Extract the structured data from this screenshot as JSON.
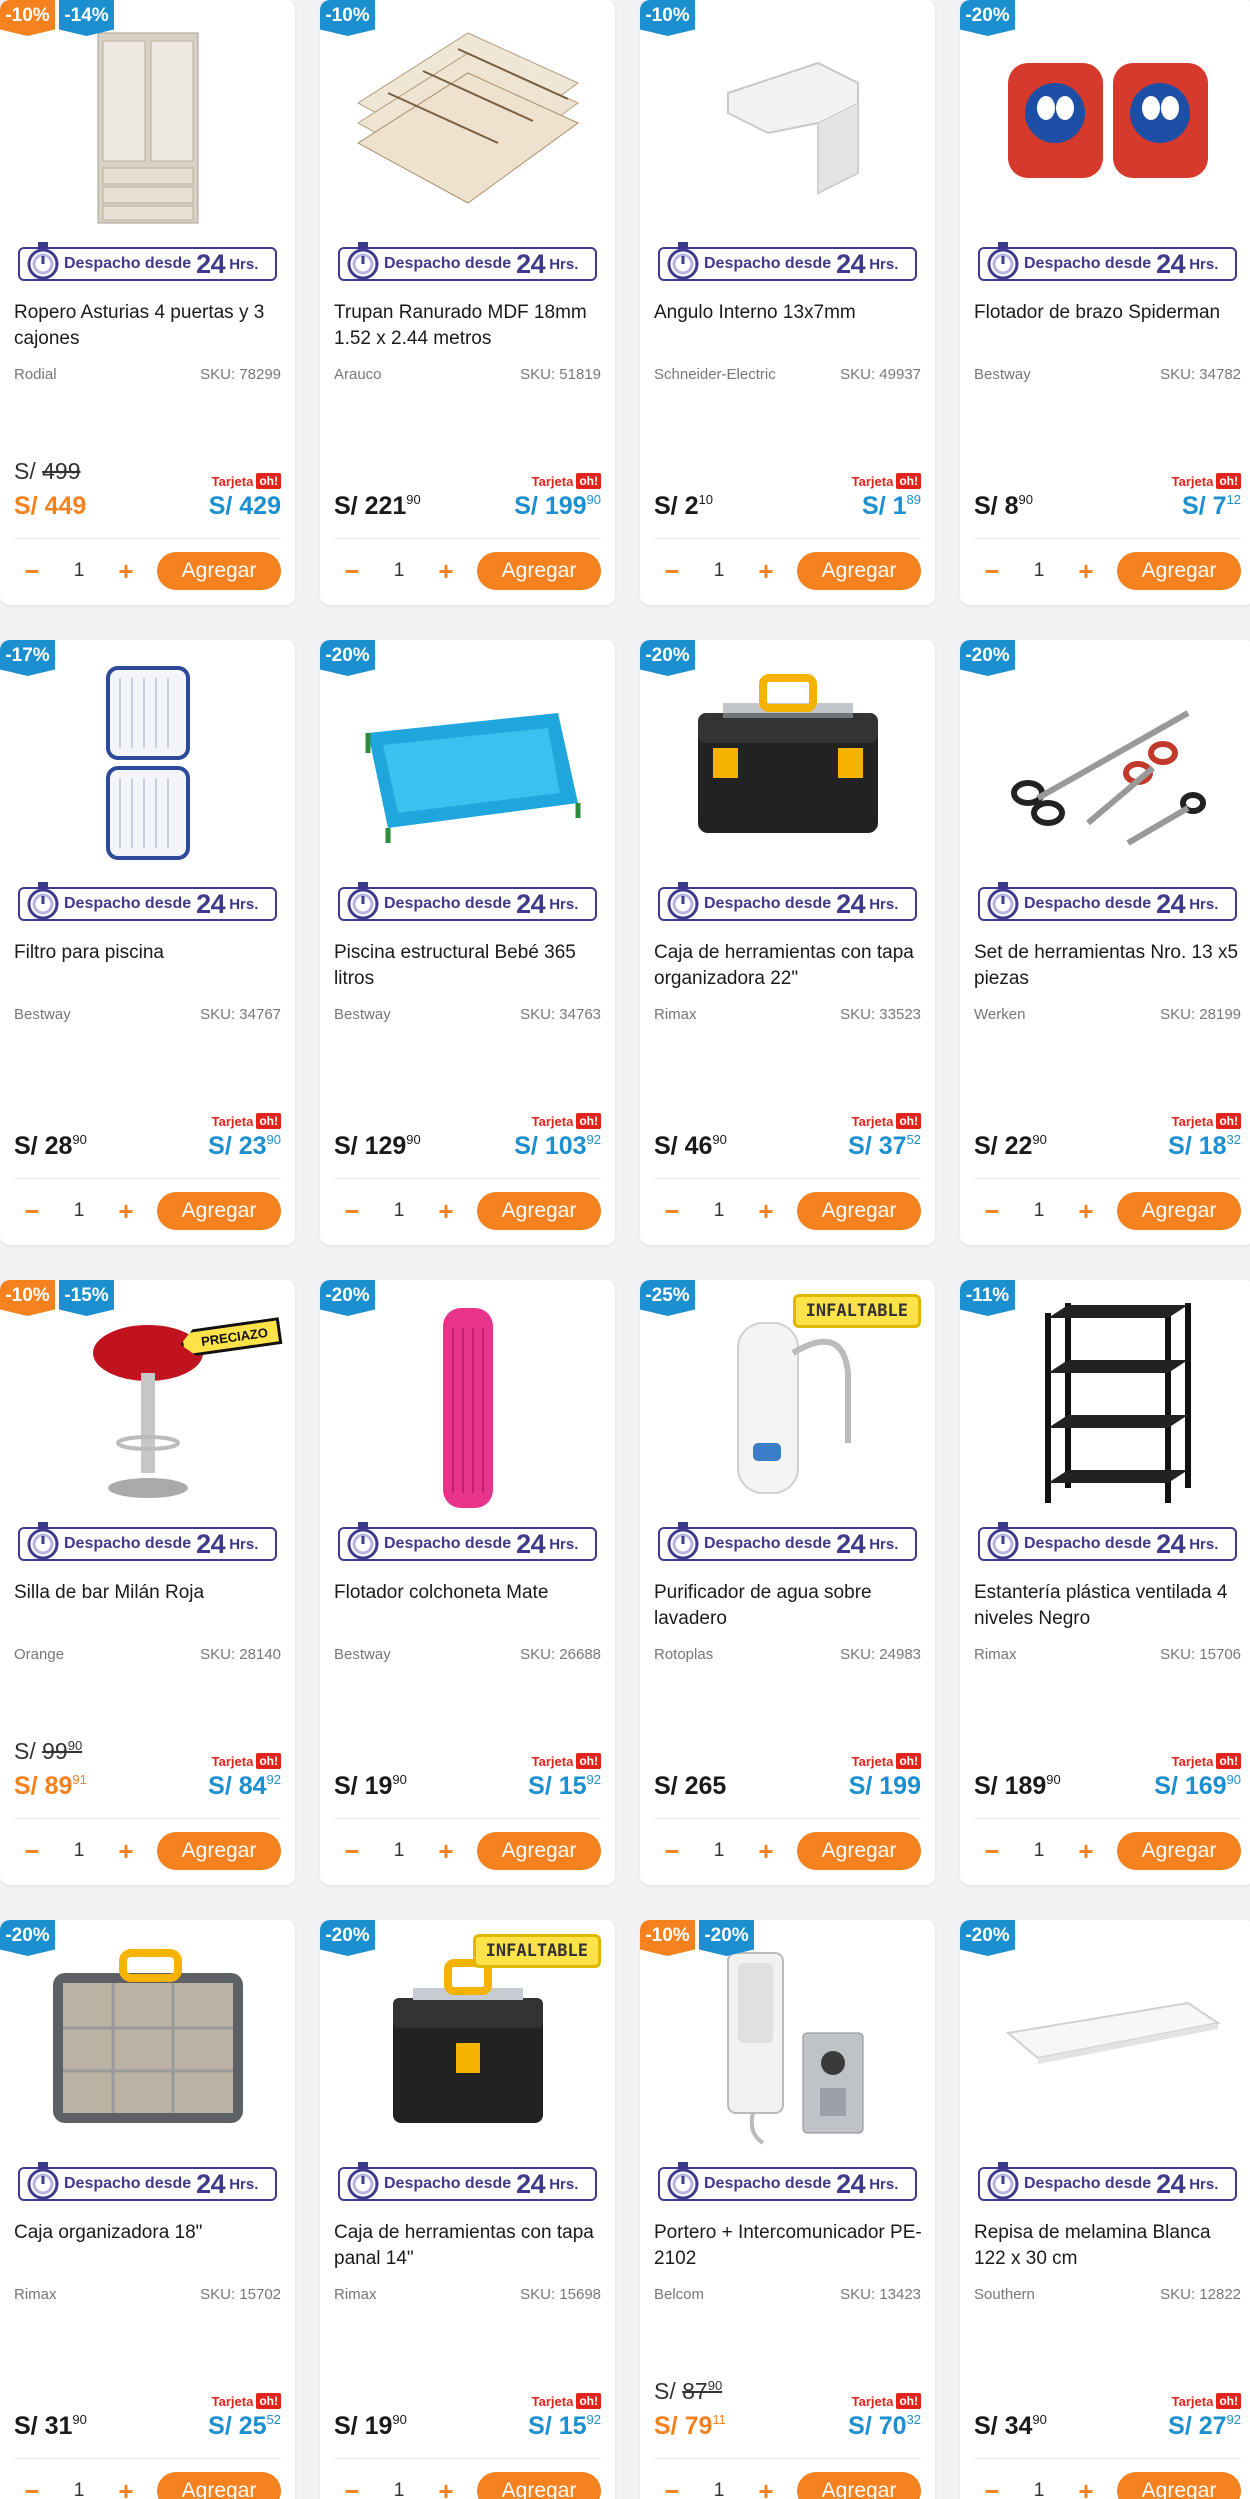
{
  "ui": {
    "despacho_prefix": "Despacho desde",
    "despacho_big": "24",
    "despacho_suffix": "Hrs.",
    "tarjeta_label": "Tarjeta",
    "oh_logo": "oh!",
    "add_label": "Agregar",
    "minus": "−",
    "plus": "+",
    "currency": "S/"
  },
  "colors": {
    "accent": "#f5821f",
    "oh_blue": "#1c8fd0",
    "oh_red": "#e2231a",
    "despacho": "#3e3a8c",
    "badge_orange": "#f5821f",
    "badge_blue": "#1c8fd0"
  },
  "products": [
    {
      "badges": [
        {
          "text": "-10%",
          "color": "orange"
        },
        {
          "text": "-14%",
          "color": "blue"
        }
      ],
      "image": "wardrobe",
      "title": "Ropero Asturias 4 puertas y 3 cajones",
      "brand": "Rodial",
      "sku": "SKU: 78299",
      "old_int": "499",
      "old_dec": "",
      "price_int": "449",
      "price_dec": "",
      "price_orange": true,
      "oh_int": "429",
      "oh_dec": "",
      "qty": "1"
    },
    {
      "badges": [
        {
          "text": "-10%",
          "color": "blue"
        }
      ],
      "image": "mdf-boards",
      "title": "Trupan Ranurado MDF 18mm 1.52 x 2.44 metros",
      "brand": "Arauco",
      "sku": "SKU: 51819",
      "old_int": "",
      "old_dec": "",
      "price_int": "221",
      "price_dec": "90",
      "price_orange": false,
      "oh_int": "199",
      "oh_dec": "90",
      "qty": "1"
    },
    {
      "badges": [
        {
          "text": "-10%",
          "color": "blue"
        }
      ],
      "image": "corner-piece",
      "title": "Angulo Interno 13x7mm",
      "brand": "Schneider-Electric",
      "sku": "SKU: 49937",
      "old_int": "",
      "old_dec": "",
      "price_int": "2",
      "price_dec": "10",
      "price_orange": false,
      "oh_int": "1",
      "oh_dec": "89",
      "qty": "1"
    },
    {
      "badges": [
        {
          "text": "-20%",
          "color": "blue"
        }
      ],
      "image": "armbands",
      "title": "Flotador de brazo Spiderman",
      "brand": "Bestway",
      "sku": "SKU: 34782",
      "old_int": "",
      "old_dec": "",
      "price_int": "8",
      "price_dec": "90",
      "price_orange": false,
      "oh_int": "7",
      "oh_dec": "12",
      "qty": "1"
    },
    {
      "badges": [
        {
          "text": "-17%",
          "color": "blue"
        }
      ],
      "image": "pool-filter",
      "title": "Filtro para piscina",
      "brand": "Bestway",
      "sku": "SKU: 34767",
      "old_int": "",
      "old_dec": "",
      "price_int": "28",
      "price_dec": "90",
      "price_orange": false,
      "oh_int": "23",
      "oh_dec": "90",
      "qty": "1"
    },
    {
      "badges": [
        {
          "text": "-20%",
          "color": "blue"
        }
      ],
      "image": "pool",
      "title": "Piscina estructural Bebé 365 litros",
      "brand": "Bestway",
      "sku": "SKU: 34763",
      "old_int": "",
      "old_dec": "",
      "price_int": "129",
      "price_dec": "90",
      "price_orange": false,
      "oh_int": "103",
      "oh_dec": "92",
      "qty": "1"
    },
    {
      "badges": [
        {
          "text": "-20%",
          "color": "blue"
        }
      ],
      "image": "toolbox-black",
      "title": "Caja de herramientas con tapa organizadora 22\"",
      "brand": "Rimax",
      "sku": "SKU: 33523",
      "old_int": "",
      "old_dec": "",
      "price_int": "46",
      "price_dec": "90",
      "price_orange": false,
      "oh_int": "37",
      "oh_dec": "52",
      "qty": "1"
    },
    {
      "badges": [
        {
          "text": "-20%",
          "color": "blue"
        }
      ],
      "image": "scissors",
      "title": "Set de herramientas Nro. 13 x5 piezas",
      "brand": "Werken",
      "sku": "SKU: 28199",
      "old_int": "",
      "old_dec": "",
      "price_int": "22",
      "price_dec": "90",
      "price_orange": false,
      "oh_int": "18",
      "oh_dec": "32",
      "qty": "1"
    },
    {
      "badges": [
        {
          "text": "-10%",
          "color": "orange"
        },
        {
          "text": "-15%",
          "color": "blue"
        }
      ],
      "image": "bar-stool",
      "tag": "PRECIAZO",
      "tag_type": "preciazo",
      "title": "Silla de bar Milán Roja",
      "brand": "Orange",
      "sku": "SKU: 28140",
      "old_int": "99",
      "old_dec": "90",
      "price_int": "89",
      "price_dec": "91",
      "price_orange": true,
      "oh_int": "84",
      "oh_dec": "92",
      "qty": "1"
    },
    {
      "badges": [
        {
          "text": "-20%",
          "color": "blue"
        }
      ],
      "image": "mattress",
      "title": "Flotador colchoneta Mate",
      "brand": "Bestway",
      "sku": "SKU: 26688",
      "old_int": "",
      "old_dec": "",
      "price_int": "19",
      "price_dec": "90",
      "price_orange": false,
      "oh_int": "15",
      "oh_dec": "92",
      "qty": "1"
    },
    {
      "badges": [
        {
          "text": "-25%",
          "color": "blue"
        }
      ],
      "image": "water-purifier",
      "tag": "INFALTABLE",
      "tag_type": "inflable",
      "title": "Purificador de agua sobre lavadero",
      "brand": "Rotoplas",
      "sku": "SKU: 24983",
      "old_int": "",
      "old_dec": "",
      "price_int": "265",
      "price_dec": "",
      "price_orange": false,
      "oh_int": "199",
      "oh_dec": "",
      "qty": "1"
    },
    {
      "badges": [
        {
          "text": "-11%",
          "color": "blue"
        }
      ],
      "image": "shelf-unit",
      "title": "Estantería plástica ventilada 4 niveles Negro",
      "brand": "Rimax",
      "sku": "SKU: 15706",
      "old_int": "",
      "old_dec": "",
      "price_int": "189",
      "price_dec": "90",
      "price_orange": false,
      "oh_int": "169",
      "oh_dec": "90",
      "qty": "1"
    },
    {
      "badges": [
        {
          "text": "-20%",
          "color": "blue"
        }
      ],
      "image": "organizer",
      "title": "Caja organizadora 18\"",
      "brand": "Rimax",
      "sku": "SKU: 15702",
      "old_int": "",
      "old_dec": "",
      "price_int": "31",
      "price_dec": "90",
      "price_orange": false,
      "oh_int": "25",
      "oh_dec": "52",
      "qty": "1"
    },
    {
      "badges": [
        {
          "text": "-20%",
          "color": "blue"
        }
      ],
      "image": "toolbox-small",
      "tag": "INFALTABLE",
      "tag_type": "inflable",
      "title": "Caja de herramientas con tapa panal 14\"",
      "brand": "Rimax",
      "sku": "SKU: 15698",
      "old_int": "",
      "old_dec": "",
      "price_int": "19",
      "price_dec": "90",
      "price_orange": false,
      "oh_int": "15",
      "oh_dec": "92",
      "qty": "1"
    },
    {
      "badges": [
        {
          "text": "-10%",
          "color": "orange"
        },
        {
          "text": "-20%",
          "color": "blue"
        }
      ],
      "image": "intercom",
      "title": "Portero + Intercomunicador PE-2102",
      "brand": "Belcom",
      "sku": "SKU: 13423",
      "old_int": "87",
      "old_dec": "90",
      "price_int": "79",
      "price_dec": "11",
      "price_orange": true,
      "oh_int": "70",
      "oh_dec": "32",
      "qty": "1"
    },
    {
      "badges": [
        {
          "text": "-20%",
          "color": "blue"
        }
      ],
      "image": "shelf-board",
      "title": "Repisa de melamina Blanca 122 x 30 cm",
      "brand": "Southern",
      "sku": "SKU: 12822",
      "old_int": "",
      "old_dec": "",
      "price_int": "34",
      "price_dec": "90",
      "price_orange": false,
      "oh_int": "27",
      "oh_dec": "92",
      "qty": "1"
    }
  ]
}
